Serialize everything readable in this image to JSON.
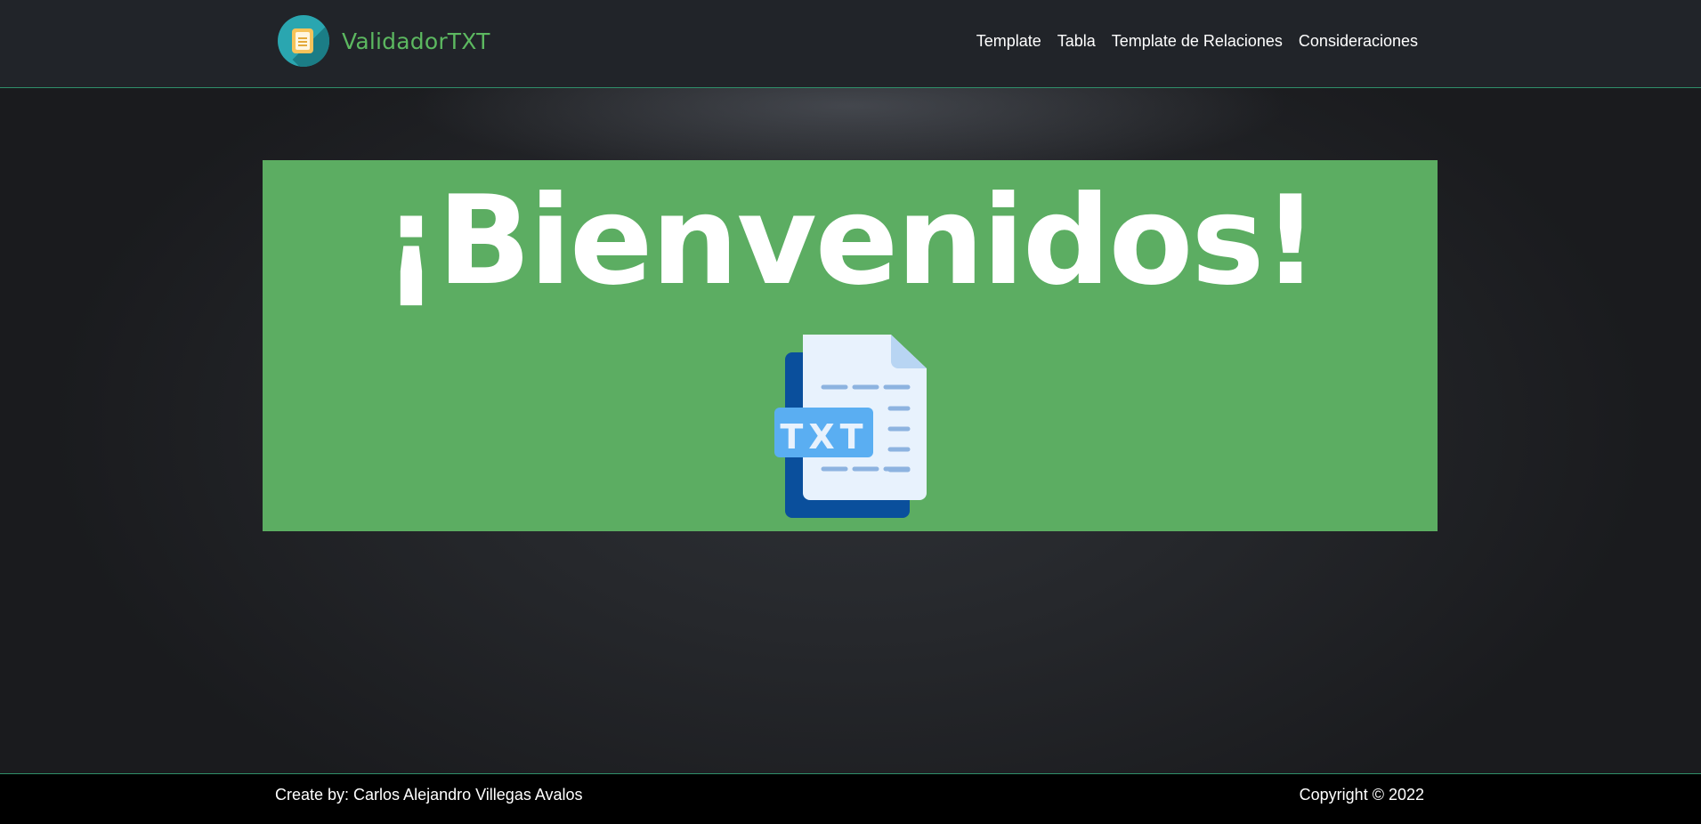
{
  "navbar": {
    "brand_name": "ValidadorTXT",
    "brand_icon": "document-logo-icon",
    "links": [
      {
        "label": "Template"
      },
      {
        "label": "Tabla"
      },
      {
        "label": "Template de Relaciones"
      },
      {
        "label": "Consideraciones"
      }
    ]
  },
  "hero": {
    "title": "¡Bienvenidos!",
    "image_icon": "txt-file-icon",
    "image_label": "TXT",
    "background_color": "#5cad62"
  },
  "footer": {
    "credit": "Create by: Carlos Alejandro Villegas Avalos",
    "copyright": "Copyright © 2022"
  },
  "colors": {
    "brand_text": "#5cb860",
    "navbar_bg": "#212429",
    "border_accent": "#2f8f6a",
    "footer_bg": "#000000"
  }
}
